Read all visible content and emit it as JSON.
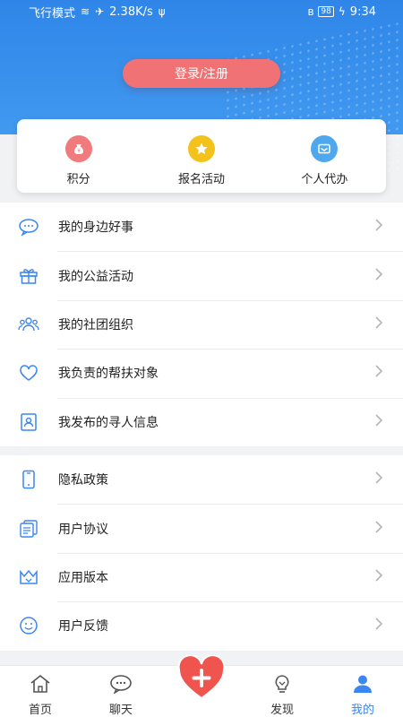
{
  "status_bar": {
    "left_text": "飞行模式",
    "speed": "2.38K/s",
    "battery": "98",
    "time": "9:34"
  },
  "login": {
    "label": "登录/注册"
  },
  "quick_actions": [
    {
      "label": "积分",
      "icon": "money-bag-icon",
      "color": "#f07a7c"
    },
    {
      "label": "报名活动",
      "icon": "star-icon",
      "color": "#f3c21b"
    },
    {
      "label": "个人代办",
      "icon": "mail-icon",
      "color": "#4fa8ee"
    }
  ],
  "menu_group_1": [
    {
      "label": "我的身边好事",
      "icon": "chat-bubble-icon"
    },
    {
      "label": "我的公益活动",
      "icon": "gift-icon"
    },
    {
      "label": "我的社团组织",
      "icon": "group-icon"
    },
    {
      "label": "我负责的帮扶对象",
      "icon": "heart-icon"
    },
    {
      "label": "我发布的寻人信息",
      "icon": "person-card-icon"
    }
  ],
  "menu_group_2": [
    {
      "label": "隐私政策",
      "icon": "phone-icon"
    },
    {
      "label": "用户协议",
      "icon": "document-stack-icon"
    },
    {
      "label": "应用版本",
      "icon": "crown-box-icon"
    },
    {
      "label": "用户反馈",
      "icon": "smile-icon"
    }
  ],
  "tabs": [
    {
      "label": "首页",
      "icon": "home-icon"
    },
    {
      "label": "聊天",
      "icon": "chat-icon"
    },
    {
      "label": "",
      "icon": "heart-plus-icon"
    },
    {
      "label": "发现",
      "icon": "bulb-icon"
    },
    {
      "label": "我的",
      "icon": "user-icon",
      "active": true
    }
  ],
  "colors": {
    "primary": "#3b86f0",
    "login": "#f07274",
    "icon_blue": "#3b86f0"
  }
}
